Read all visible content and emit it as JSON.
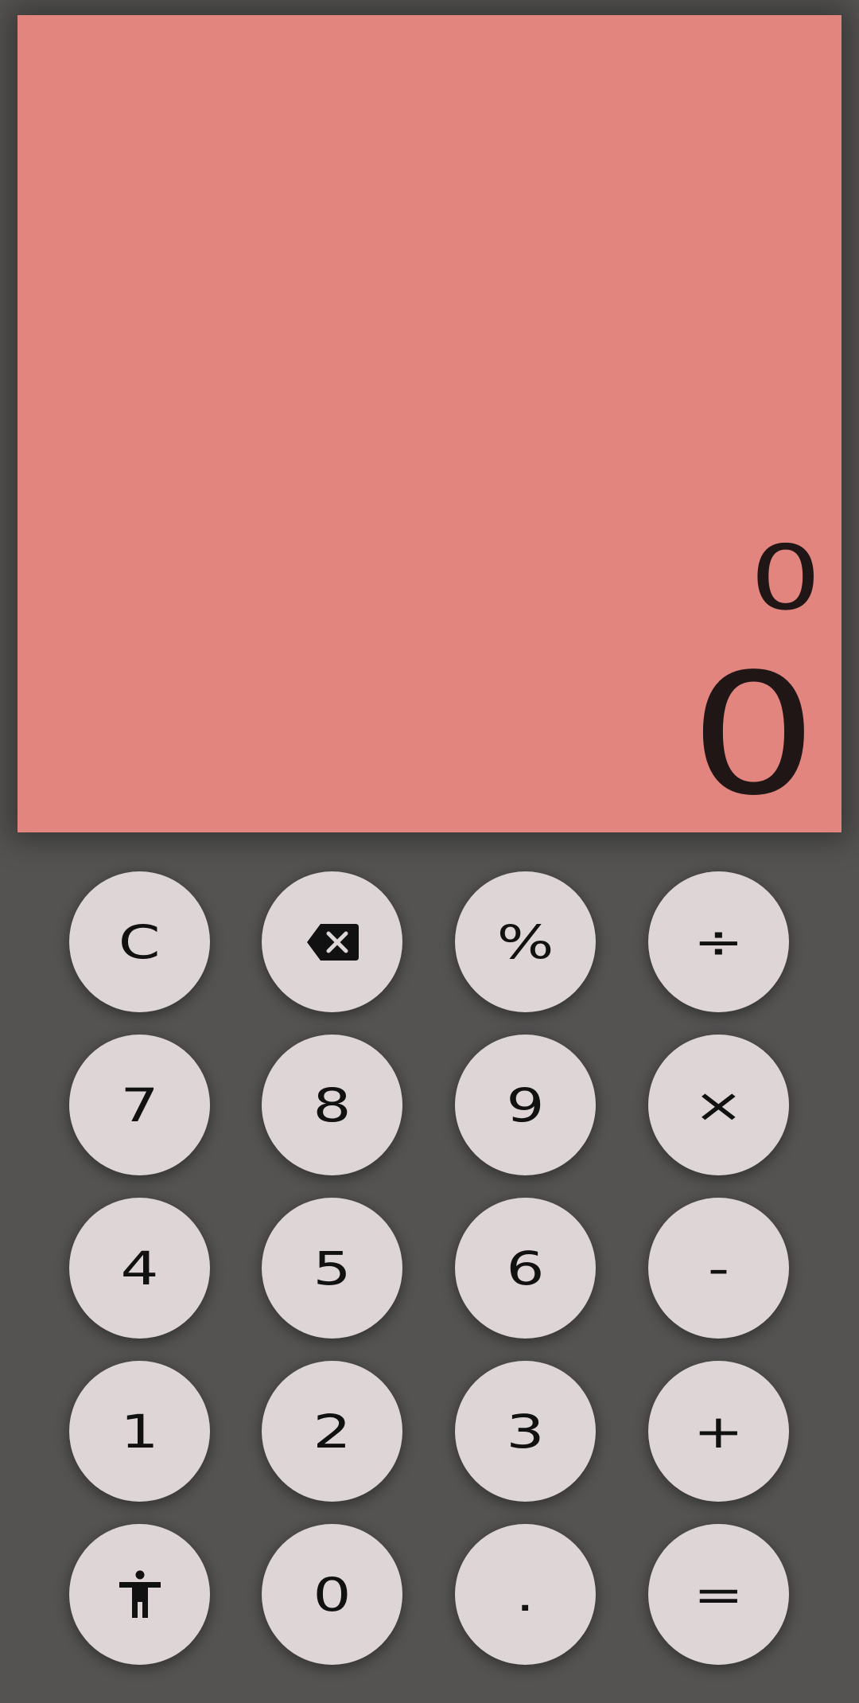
{
  "display": {
    "expression": "0",
    "result": "0"
  },
  "colors": {
    "background": "#545352",
    "display": "#e2857f",
    "key": "#ded6d6",
    "text": "#201616"
  },
  "keys": {
    "clear": "C",
    "backspace_icon": "backspace-icon",
    "percent": "%",
    "divide": "÷",
    "seven": "7",
    "eight": "8",
    "nine": "9",
    "multiply": "×",
    "four": "4",
    "five": "5",
    "six": "6",
    "subtract": "-",
    "one": "1",
    "two": "2",
    "three": "3",
    "add": "+",
    "accessibility_icon": "accessibility-icon",
    "zero": "0",
    "decimal": ".",
    "equals": "="
  }
}
